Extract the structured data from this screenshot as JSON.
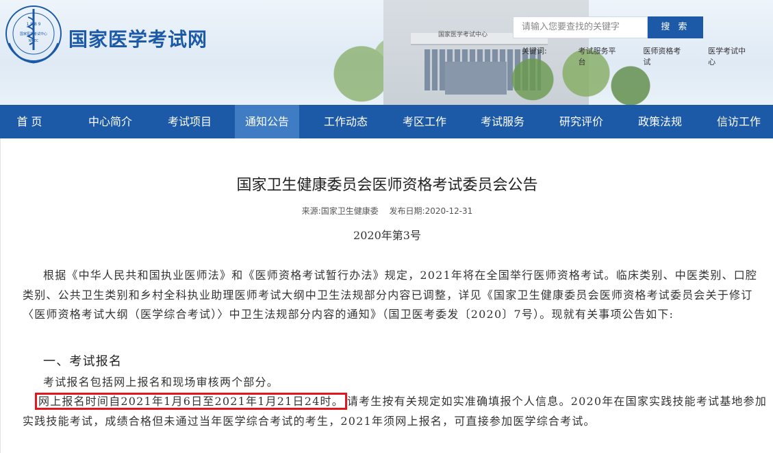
{
  "site": {
    "name": "国家医学考试网",
    "logo_text_top": "1 9 8 9",
    "logo_text_mid": "国家医学考试中心",
    "logo_text_bottom": "NMEC",
    "building_sign": "国家医学考试中心"
  },
  "search": {
    "placeholder": "请输入您要查找的关键字",
    "button_label": "搜 索"
  },
  "keywords": {
    "label": "关键词:",
    "items": [
      "考试服务平台",
      "医师资格考试",
      "医学考试中心"
    ]
  },
  "nav": {
    "items": [
      {
        "label": "首 页"
      },
      {
        "label": "中心简介"
      },
      {
        "label": "考试项目"
      },
      {
        "label": "通知公告"
      },
      {
        "label": "工作动态"
      },
      {
        "label": "考区工作"
      },
      {
        "label": "考试服务"
      },
      {
        "label": "研究评价"
      },
      {
        "label": "政策法规"
      },
      {
        "label": "信访工作"
      }
    ],
    "active": "通知公告"
  },
  "article": {
    "title": "国家卫生健康委员会医师资格考试委员会公告",
    "source": "来源:国家卫生健康委",
    "date": "发布日期:2020-12-31",
    "doc_no": "2020年第3号",
    "para1": "根据《中华人民共和国执业医师法》和《医师资格考试暂行办法》规定，2021年将在全国举行医师资格考试。临床类别、中医类别、口腔类别、公共卫生类别和乡村全科执业助理医师考试大纲中卫生法规部分内容已调整，详见《国家卫生健康委员会医师资格考试委员会关于修订〈医师资格考试大纲（医学综合考试）〉中卫生法规部分内容的通知》（国卫医考委发〔2020〕7号）。现就有关事项公告如下:",
    "section1": "一、考试报名",
    "para2": "考试报名包括网上报名和现场审核两个部分。",
    "highlight": "网上报名时间自2021年1月6日至2021年1月21日24时。",
    "para3_rest": "请考生按有关规定如实准确填报个人信息。2020年在国家实践技能考试基地参加实践技能考试，成绩合格但未通过当年医学综合考试的考生，2021年须网上报名，可直接参加医学综合考试。"
  },
  "colors": {
    "brand_blue": "#1c5aa8",
    "nav_active": "#3f7cc4",
    "highlight_red": "#e3161e"
  }
}
